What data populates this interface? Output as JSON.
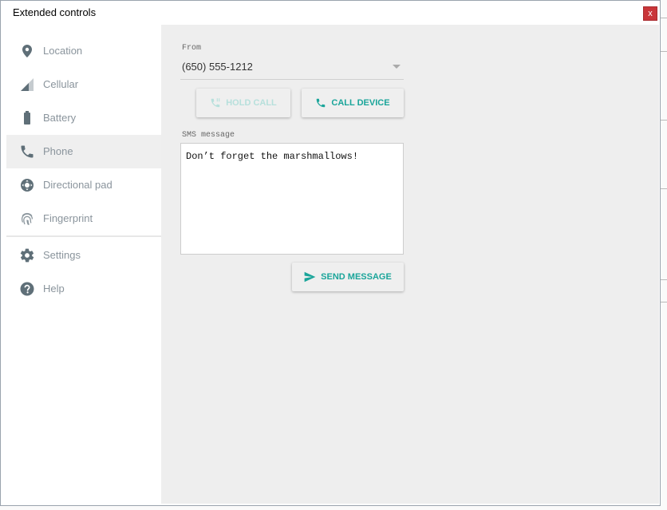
{
  "window": {
    "title": "Extended controls",
    "close_label": "x"
  },
  "sidebar": {
    "items": [
      {
        "label": "Location",
        "icon": "location-pin-icon"
      },
      {
        "label": "Cellular",
        "icon": "cellular-signal-icon"
      },
      {
        "label": "Battery",
        "icon": "battery-icon"
      },
      {
        "label": "Phone",
        "icon": "phone-icon",
        "active": true
      },
      {
        "label": "Directional pad",
        "icon": "dpad-icon"
      },
      {
        "label": "Fingerprint",
        "icon": "fingerprint-icon"
      },
      {
        "label": "Settings",
        "icon": "gear-icon"
      },
      {
        "label": "Help",
        "icon": "help-icon"
      }
    ]
  },
  "phone": {
    "from_label": "From",
    "from_value": "(650) 555-1212",
    "hold_call_label": "HOLD CALL",
    "call_device_label": "CALL DEVICE",
    "sms_label": "SMS message",
    "sms_value": "Don’t forget the marshmallows!",
    "send_label": "SEND MESSAGE"
  },
  "colors": {
    "accent": "#1aa59a",
    "icon": "#5f6f78",
    "close": "#c9363a",
    "content_bg": "#eeeeee"
  }
}
